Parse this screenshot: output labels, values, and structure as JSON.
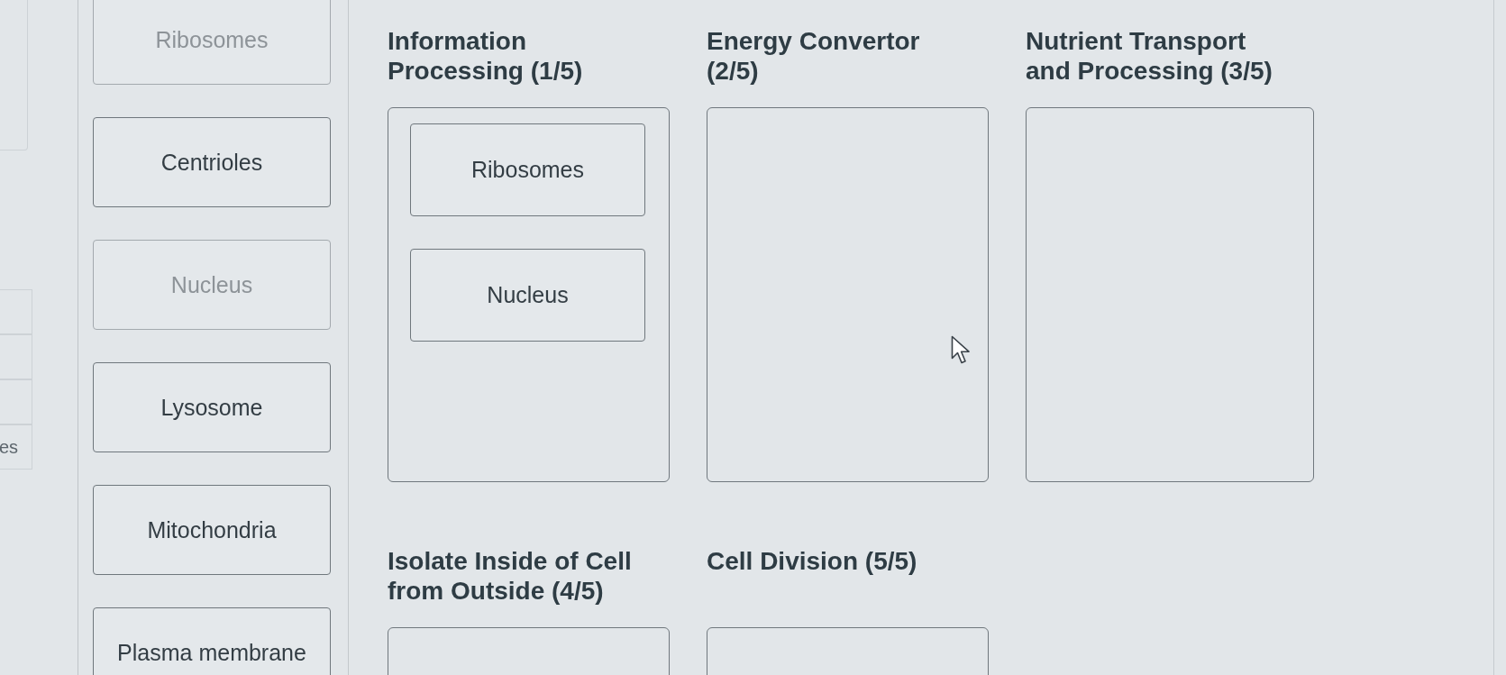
{
  "left_panel": {
    "visible_label": "es"
  },
  "word_bank": [
    {
      "label": "Ribosomes",
      "placed": true
    },
    {
      "label": "Centrioles",
      "placed": false
    },
    {
      "label": "Nucleus",
      "placed": true
    },
    {
      "label": "Lysosome",
      "placed": false
    },
    {
      "label": "Mitochondria",
      "placed": false
    },
    {
      "label": "Plasma membrane",
      "placed": false
    }
  ],
  "categories": [
    {
      "title": "Information Processing (1/5)",
      "items": [
        {
          "label": "Ribosomes"
        },
        {
          "label": "Nucleus"
        }
      ]
    },
    {
      "title": "Energy Convertor (2/5)"
    },
    {
      "title": "Nutrient Transport and Processing (3/5)"
    },
    {
      "title": "Isolate Inside of Cell from Outside (4/5)"
    },
    {
      "title": "Cell Division (5/5)"
    }
  ]
}
